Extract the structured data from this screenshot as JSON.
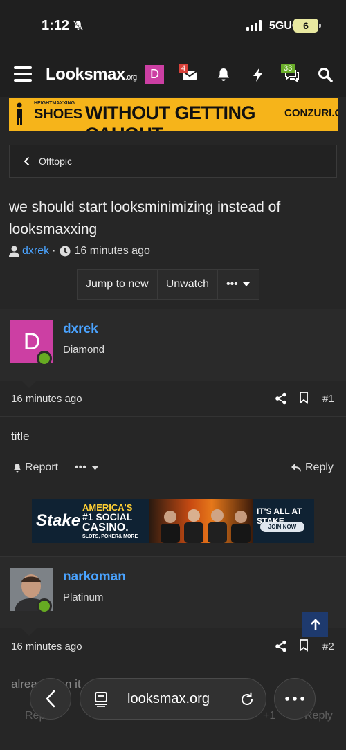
{
  "status_bar": {
    "time": "1:12",
    "network": "5GUC",
    "battery": "6"
  },
  "nav": {
    "logo_main": "Looksmax",
    "logo_suffix": ".org",
    "user_initial": "D",
    "inbox_badge": "4",
    "alerts_badge": "33"
  },
  "ad_top": {
    "small_text": "HEIGHTMAXXING",
    "product": "SHOES",
    "headline": "WITHOUT GETTING CAUGHT",
    "site": "CONZURI.COM"
  },
  "breadcrumb": {
    "label": "Offtopic"
  },
  "thread": {
    "title": "we should start looksminimizing instead of looksmaxxing",
    "author": "dxrek",
    "separator": "·",
    "time": "16 minutes ago"
  },
  "thread_buttons": {
    "jump": "Jump to new",
    "watch": "Unwatch",
    "more": "•••"
  },
  "posts": [
    {
      "avatar_initial": "D",
      "username": "dxrek",
      "rank": "Diamond",
      "time": "16 minutes ago",
      "number": "#1",
      "body": "title",
      "report": "Report",
      "more": "•••",
      "reply": "Reply"
    },
    {
      "username": "narkoman",
      "rank": "Platinum",
      "time": "16 minutes ago",
      "number": "#2",
      "body_partial_1": "alrea",
      "body_partial_2": "n it",
      "report": "Rep",
      "plus_one": "+1",
      "reply": "Reply"
    }
  ],
  "ad_stake": {
    "brand": "Stake",
    "line1": "AMERICA'S",
    "line2": "#1 SOCIAL",
    "line3": "CASINO.",
    "line4": "SLOTS, POKER& MORE",
    "tagline": "IT'S ALL AT STAKE",
    "cta": "JOIN NOW"
  },
  "browser": {
    "url": "looksmax.org"
  },
  "colors": {
    "link": "#4aa3ff",
    "online": "#66aa22",
    "avatar_bg": "#cc3fa3",
    "scroll_btn": "#1e3a6e"
  }
}
